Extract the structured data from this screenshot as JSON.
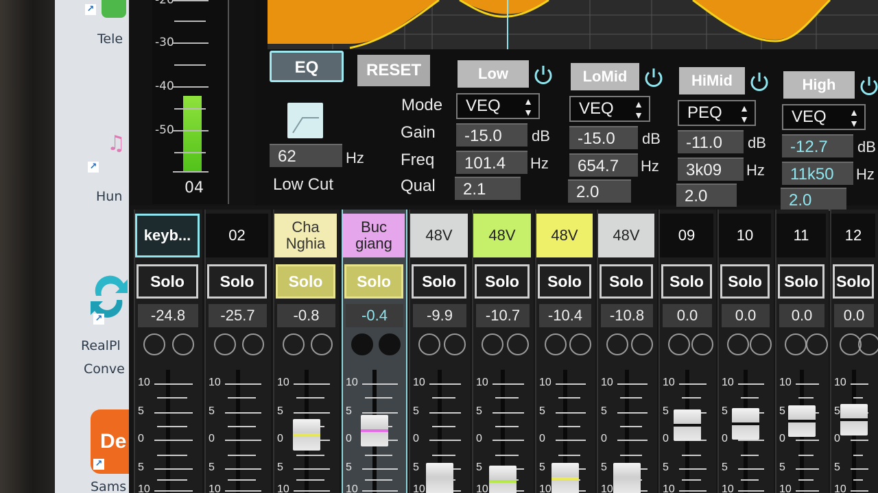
{
  "desktop": {
    "icons": [
      {
        "label": "Tele",
        "icon": "telegram-icon"
      },
      {
        "label": "Hun",
        "icon": "music-app-icon"
      },
      {
        "label": "RealPl",
        "label2": "Conve",
        "icon": "realplayer-converter-icon"
      },
      {
        "label": "Sams",
        "badge": "De",
        "icon": "samsung-dex-icon"
      }
    ]
  },
  "meter": {
    "ticks": [
      "-20",
      "-30",
      "-40",
      "-50"
    ],
    "channel": "04",
    "level_fraction": 0.35
  },
  "eq": {
    "eq_button": "EQ",
    "reset_button": "RESET",
    "low_cut": {
      "value": "62",
      "unit": "Hz",
      "label": "Low Cut"
    },
    "param_labels": {
      "mode": "Mode",
      "gain": "Gain",
      "freq": "Freq",
      "qual": "Qual"
    },
    "bands": [
      {
        "name": "Low",
        "mode": "VEQ",
        "gain": "-15.0",
        "gain_unit": "dB",
        "freq": "101.4",
        "freq_unit": "Hz",
        "qual": "2.1"
      },
      {
        "name": "LoMid",
        "mode": "VEQ",
        "gain": "-15.0",
        "gain_unit": "dB",
        "freq": "654.7",
        "freq_unit": "Hz",
        "qual": "2.0"
      },
      {
        "name": "HiMid",
        "mode": "PEQ",
        "gain": "-11.0",
        "gain_unit": "dB",
        "freq": "3k09",
        "freq_unit": "Hz",
        "qual": "2.0"
      },
      {
        "name": "High",
        "mode": "VEQ",
        "gain": "-12.7",
        "gain_unit": "dB",
        "freq": "11k50",
        "freq_unit": "Hz",
        "qual": "2.0"
      }
    ],
    "colors": {
      "curve_fill": "#e8920f",
      "curve_line": "#f5d21a",
      "accent": "#8fe6ef"
    }
  },
  "channels": [
    {
      "name": "keyb...",
      "solo": "Solo",
      "level": "-24.8"
    },
    {
      "name": "02",
      "solo": "Solo",
      "level": "-25.7"
    },
    {
      "name": "Cha",
      "name2": "Nghia",
      "solo": "Solo",
      "level": "-0.8"
    },
    {
      "name": "Buc",
      "name2": "giang",
      "solo": "Solo",
      "level": "-0.4"
    },
    {
      "name": "48V",
      "solo": "Solo",
      "level": "-9.9"
    },
    {
      "name": "48V",
      "solo": "Solo",
      "level": "-10.7"
    },
    {
      "name": "48V",
      "solo": "Solo",
      "level": "-10.4"
    },
    {
      "name": "48V",
      "solo": "Solo",
      "level": "-10.8"
    },
    {
      "name": "09",
      "solo": "Solo",
      "level": "0.0"
    },
    {
      "name": "10",
      "solo": "Solo",
      "level": "0.0"
    },
    {
      "name": "11",
      "solo": "Solo",
      "level": "0.0"
    },
    {
      "name": "12",
      "solo": "Solo",
      "level": "0.0"
    }
  ],
  "fader_scale": [
    "10",
    "5",
    "0",
    "5",
    "10"
  ]
}
